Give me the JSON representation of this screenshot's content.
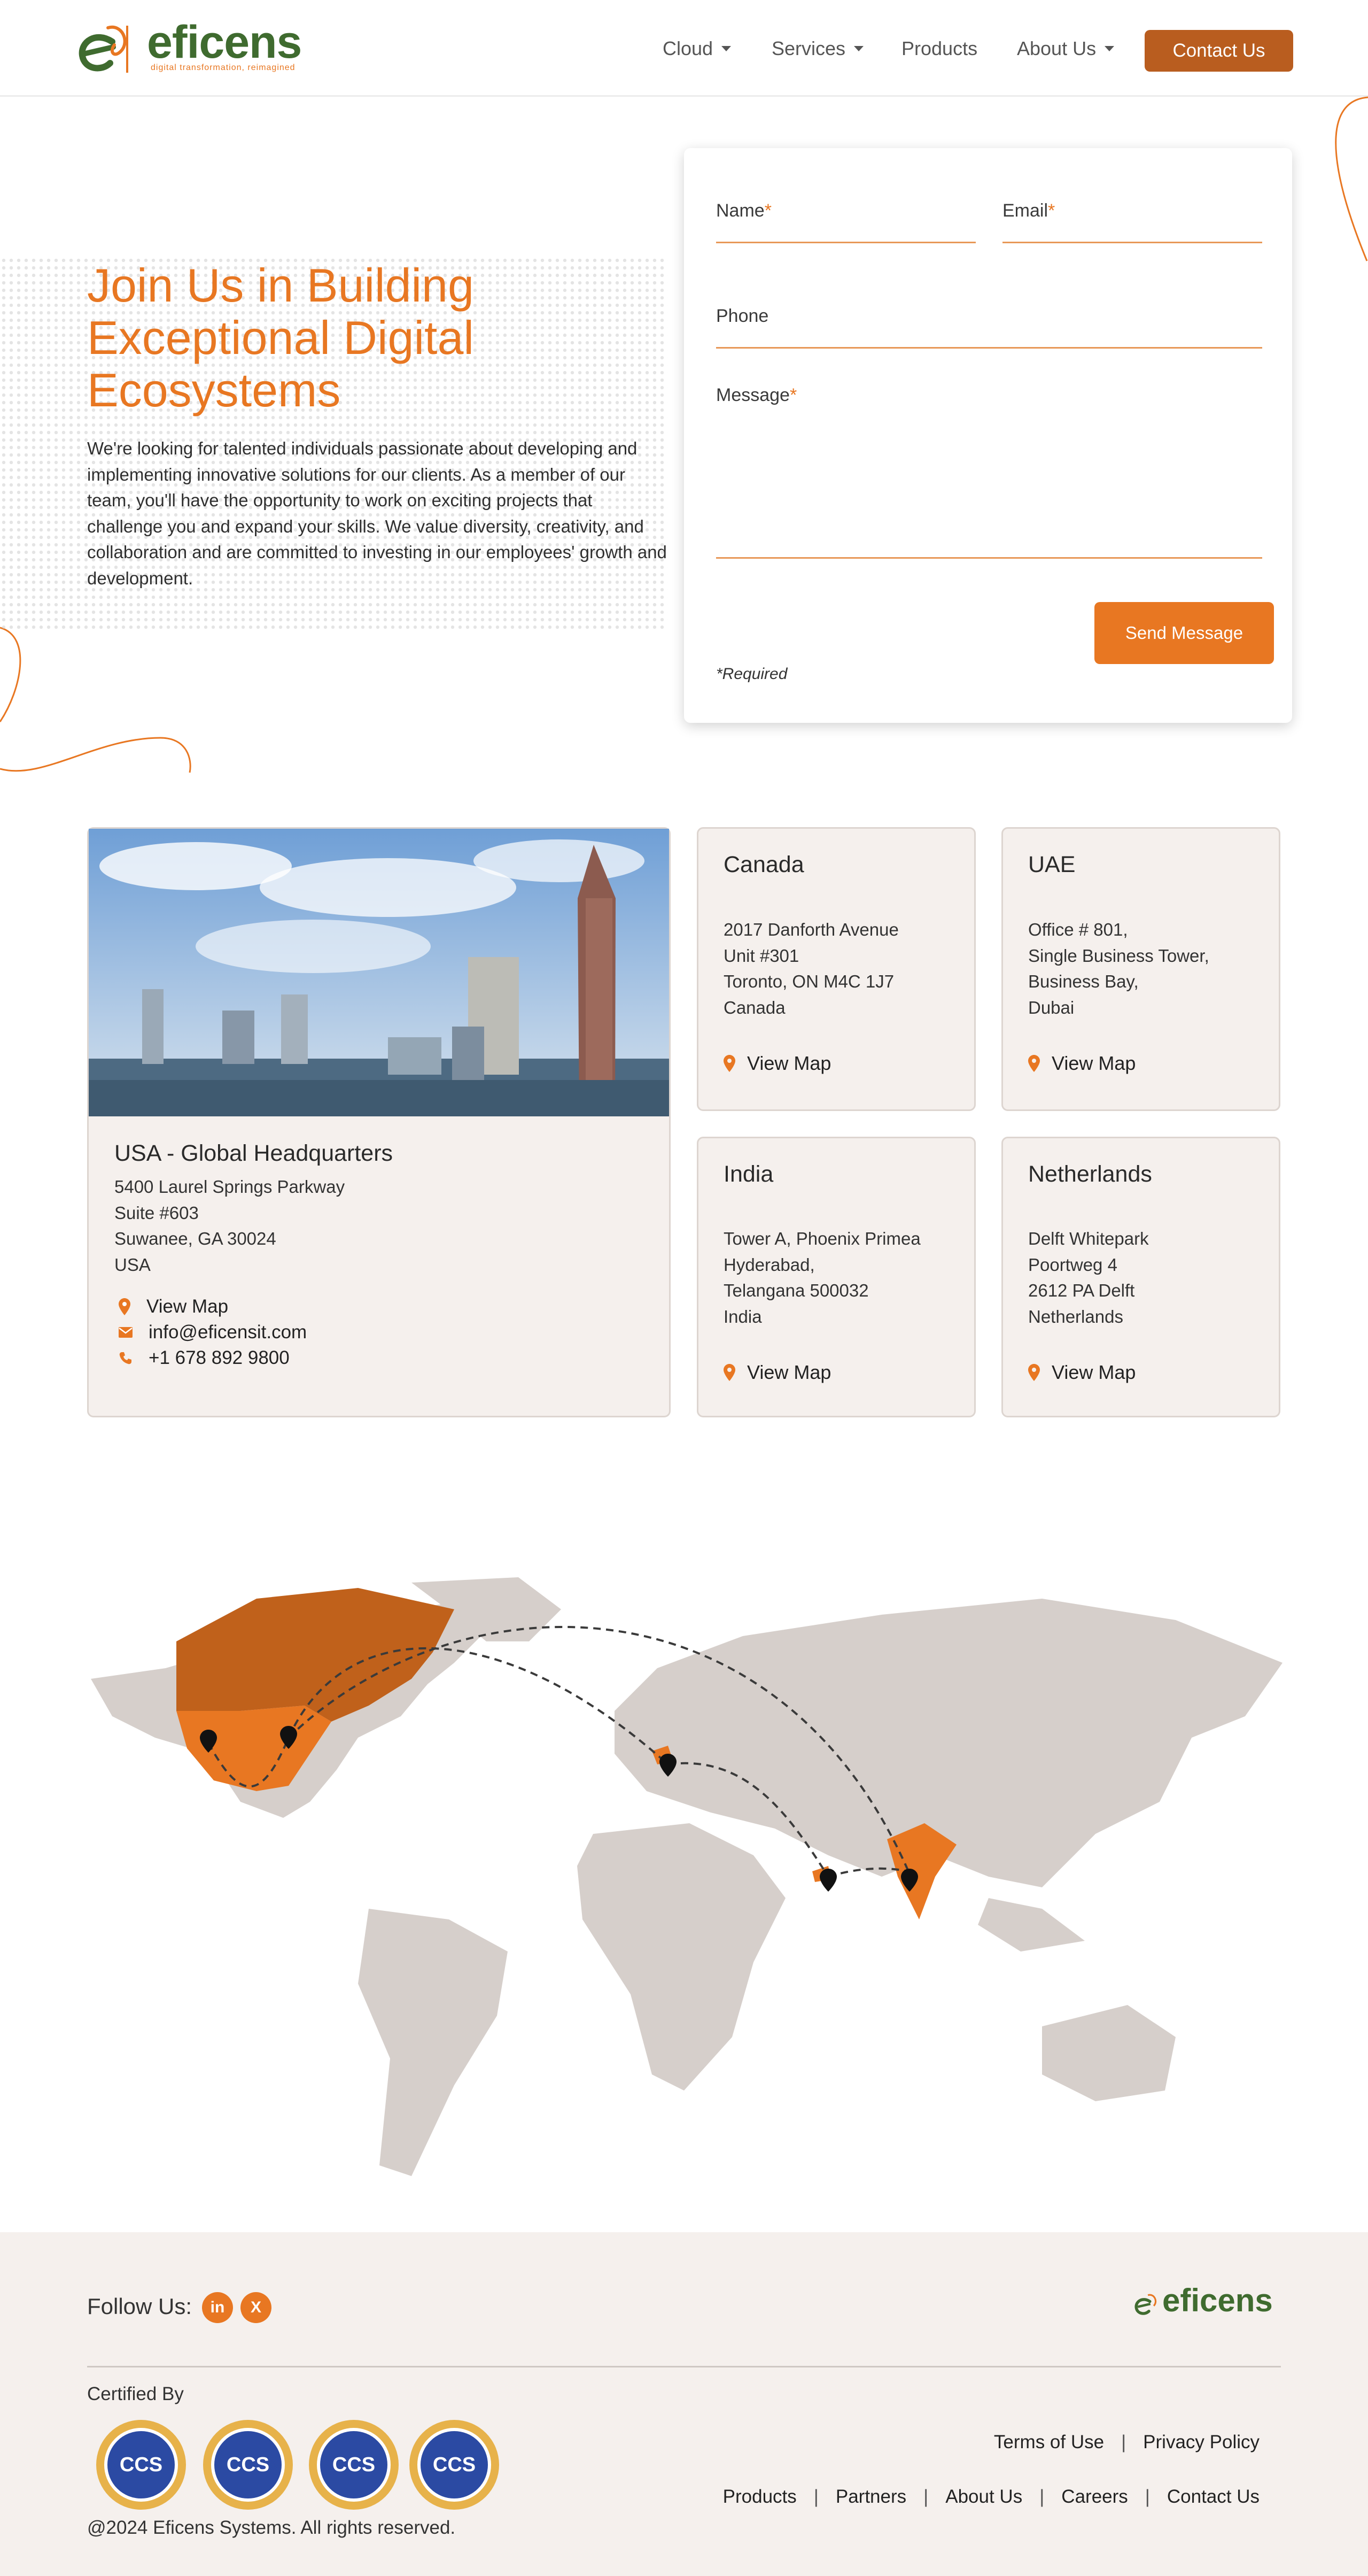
{
  "nav": {
    "logo": {
      "text": "eficens",
      "tagline": "digital transformation, reimagined"
    },
    "items": [
      {
        "label": "Cloud",
        "has_dropdown": true
      },
      {
        "label": "Services",
        "has_dropdown": true
      },
      {
        "label": "Products",
        "has_dropdown": false
      },
      {
        "label": "About Us",
        "has_dropdown": true
      }
    ],
    "cta": "Contact Us"
  },
  "hero": {
    "title": "Join Us in Building Exceptional Digital Ecosystems",
    "body": "We're looking for talented individuals passionate about developing and implementing innovative solutions for our clients. As a member of our team, you'll have the opportunity to work on exciting projects that challenge you and expand your skills. We value diversity, creativity, and collaboration and are committed to investing in our employees' growth and development."
  },
  "form": {
    "name_label": "Name",
    "email_label": "Email",
    "phone_label": "Phone",
    "message_label": "Message",
    "required_marker": "*",
    "submit": "Send Message",
    "required_note": "*Required"
  },
  "offices": {
    "hq": {
      "title": "USA - Global Headquarters",
      "address": "5400 Laurel Springs Parkway\nSuite #603\nSuwanee, GA 30024\nUSA",
      "view_map": "View Map",
      "email": "info@eficensit.com",
      "phone": "+1 678 892 9800"
    },
    "canada": {
      "title": "Canada",
      "address": "2017 Danforth Avenue\nUnit #301\nToronto, ON M4C 1J7\nCanada",
      "view_map": "View Map"
    },
    "uae": {
      "title": "UAE",
      "address": "Office # 801,\nSingle Business Tower,\nBusiness Bay,\nDubai",
      "view_map": "View Map"
    },
    "india": {
      "title": "India",
      "address": "Tower A, Phoenix Primea\nHyderabad,\nTelangana 500032\nIndia",
      "view_map": "View Map"
    },
    "netherlands": {
      "title": "Netherlands",
      "address": "Delft Whitepark\nPoortweg 4\n2612 PA Delft\nNetherlands",
      "view_map": "View Map"
    }
  },
  "footer": {
    "follow_label": "Follow Us:",
    "social": [
      {
        "icon": "linkedin-icon",
        "glyph": "in"
      },
      {
        "icon": "x-icon",
        "glyph": "X"
      }
    ],
    "logo_text": "eficens",
    "certified_label": "Certified By",
    "badges": [
      "CCS",
      "CCS",
      "CCS",
      "CCS"
    ],
    "links_top": [
      "Terms of Use",
      "Privacy Policy"
    ],
    "links_bottom": [
      "Products",
      "Partners",
      "About Us",
      "Careers",
      "Contact Us"
    ],
    "copyright": "@2024 Eficens Systems. All rights reserved."
  },
  "colors": {
    "brand_orange": "#e87722",
    "brand_dark_orange": "#b95d1f",
    "brand_green": "#3f6b2f",
    "card_bg": "#f5f0ed"
  }
}
